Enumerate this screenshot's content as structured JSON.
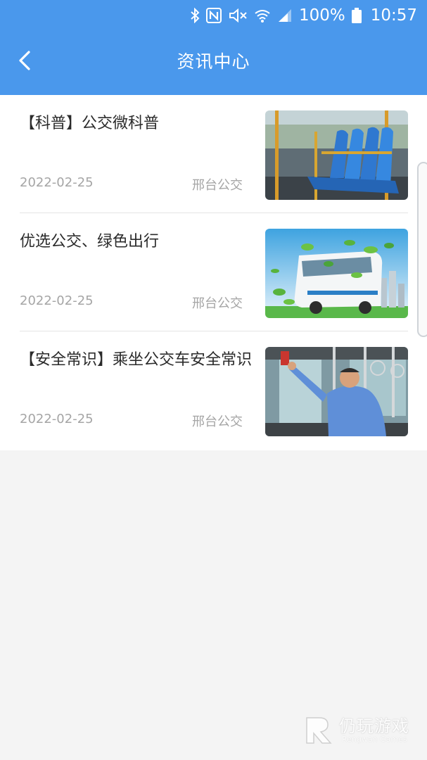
{
  "status_bar": {
    "battery_percent": "100%",
    "time": "10:57",
    "icons": [
      "bluetooth-icon",
      "nfc-icon",
      "mute-icon",
      "wifi-icon",
      "signal-icon",
      "battery-icon"
    ]
  },
  "header": {
    "title": "资讯中心",
    "back_icon": "chevron-left-icon",
    "background_color": "#4a98ec"
  },
  "news": [
    {
      "title": "【科普】公交微科普",
      "date": "2022-02-25",
      "source": "邢台公交",
      "image": "bus-seats-photo"
    },
    {
      "title": "优选公交、绿色出行",
      "date": "2022-02-25",
      "source": "邢台公交",
      "image": "green-bus-photo"
    },
    {
      "title": "【安全常识】乘坐公交车安全常识",
      "date": "2022-02-25",
      "source": "邢台公交",
      "image": "bus-officer-photo"
    }
  ],
  "watermark": {
    "name_cn": "仍玩游戏",
    "name_en": "Rengwan Games"
  }
}
